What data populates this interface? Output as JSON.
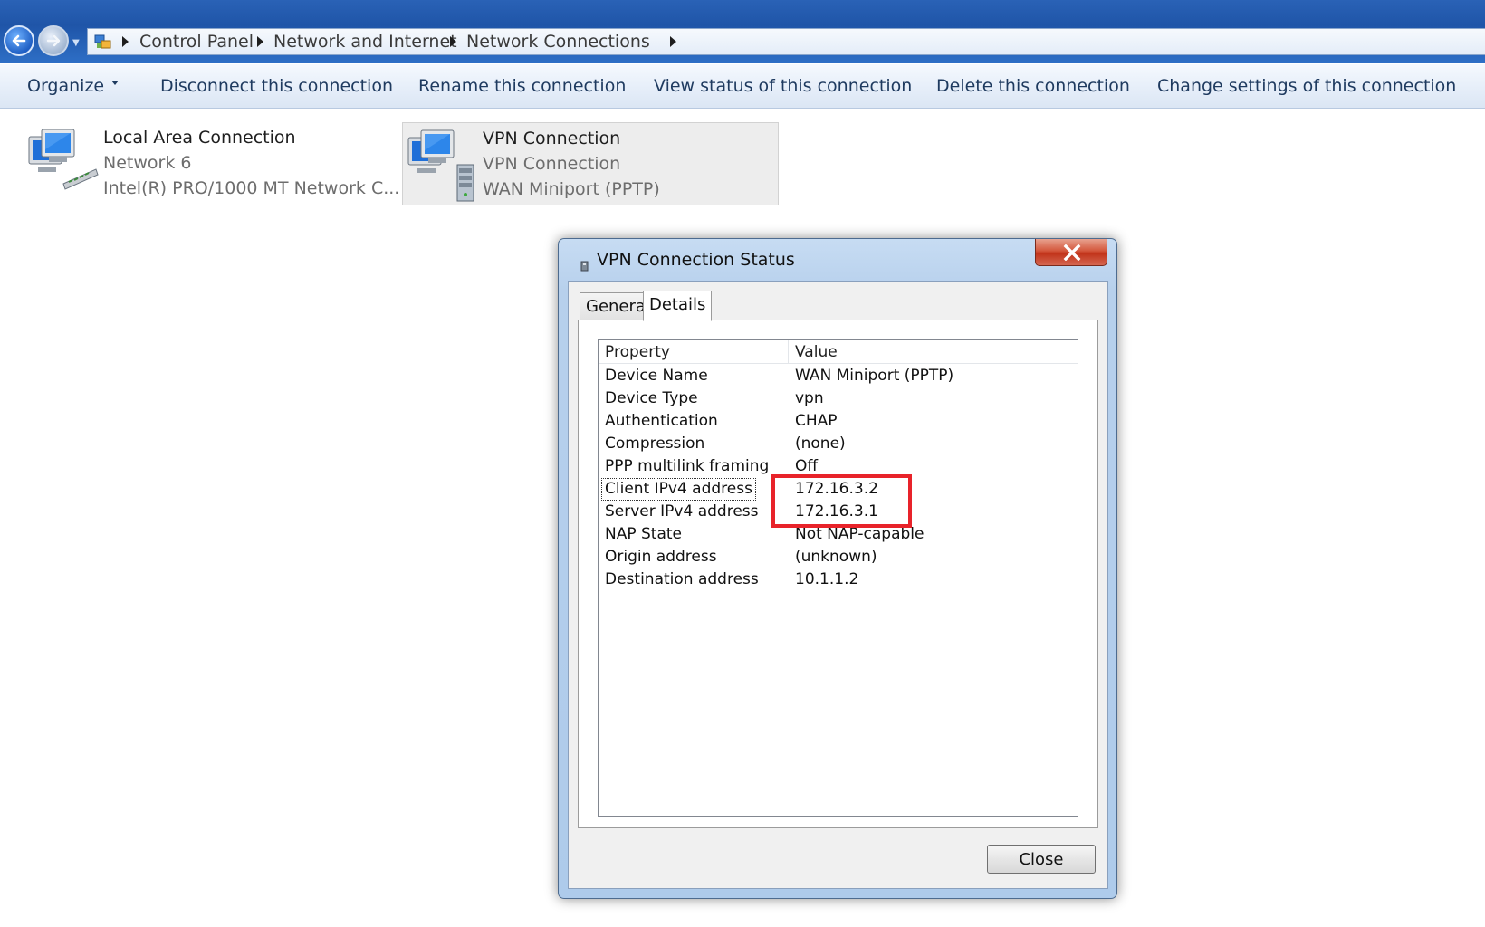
{
  "breadcrumb": {
    "items": [
      "Control Panel",
      "Network and Internet",
      "Network Connections"
    ]
  },
  "commandbar": {
    "organize": "Organize",
    "disconnect": "Disconnect this connection",
    "rename": "Rename this connection",
    "view_status": "View status of this connection",
    "delete": "Delete this connection",
    "change_settings": "Change settings of this connection"
  },
  "connections": [
    {
      "name": "Local Area Connection",
      "subtitle": "Network  6",
      "device": "Intel(R) PRO/1000 MT Network C...",
      "icon": "network-adapter-icon"
    },
    {
      "name": "VPN Connection",
      "subtitle": "VPN Connection",
      "device": "WAN Miniport (PPTP)",
      "icon": "vpn-connection-icon"
    }
  ],
  "dialog": {
    "title": "VPN Connection Status",
    "tabs": [
      "General",
      "Details"
    ],
    "active_tab": "Details",
    "columns": {
      "property": "Property",
      "value": "Value"
    },
    "rows": [
      {
        "property": "Device Name",
        "value": "WAN Miniport (PPTP)"
      },
      {
        "property": "Device Type",
        "value": "vpn"
      },
      {
        "property": "Authentication",
        "value": "CHAP"
      },
      {
        "property": "Compression",
        "value": "(none)"
      },
      {
        "property": "PPP multilink framing",
        "value": "Off"
      },
      {
        "property": "Client IPv4 address",
        "value": "172.16.3.2"
      },
      {
        "property": "Server IPv4 address",
        "value": "172.16.3.1"
      },
      {
        "property": "NAP State",
        "value": "Not NAP-capable"
      },
      {
        "property": "Origin address",
        "value": "(unknown)"
      },
      {
        "property": "Destination address",
        "value": "10.1.1.2"
      }
    ],
    "close_button": "Close"
  },
  "colors": {
    "highlight": "#e8232a",
    "titlebar_accent": "#2a62b6"
  }
}
